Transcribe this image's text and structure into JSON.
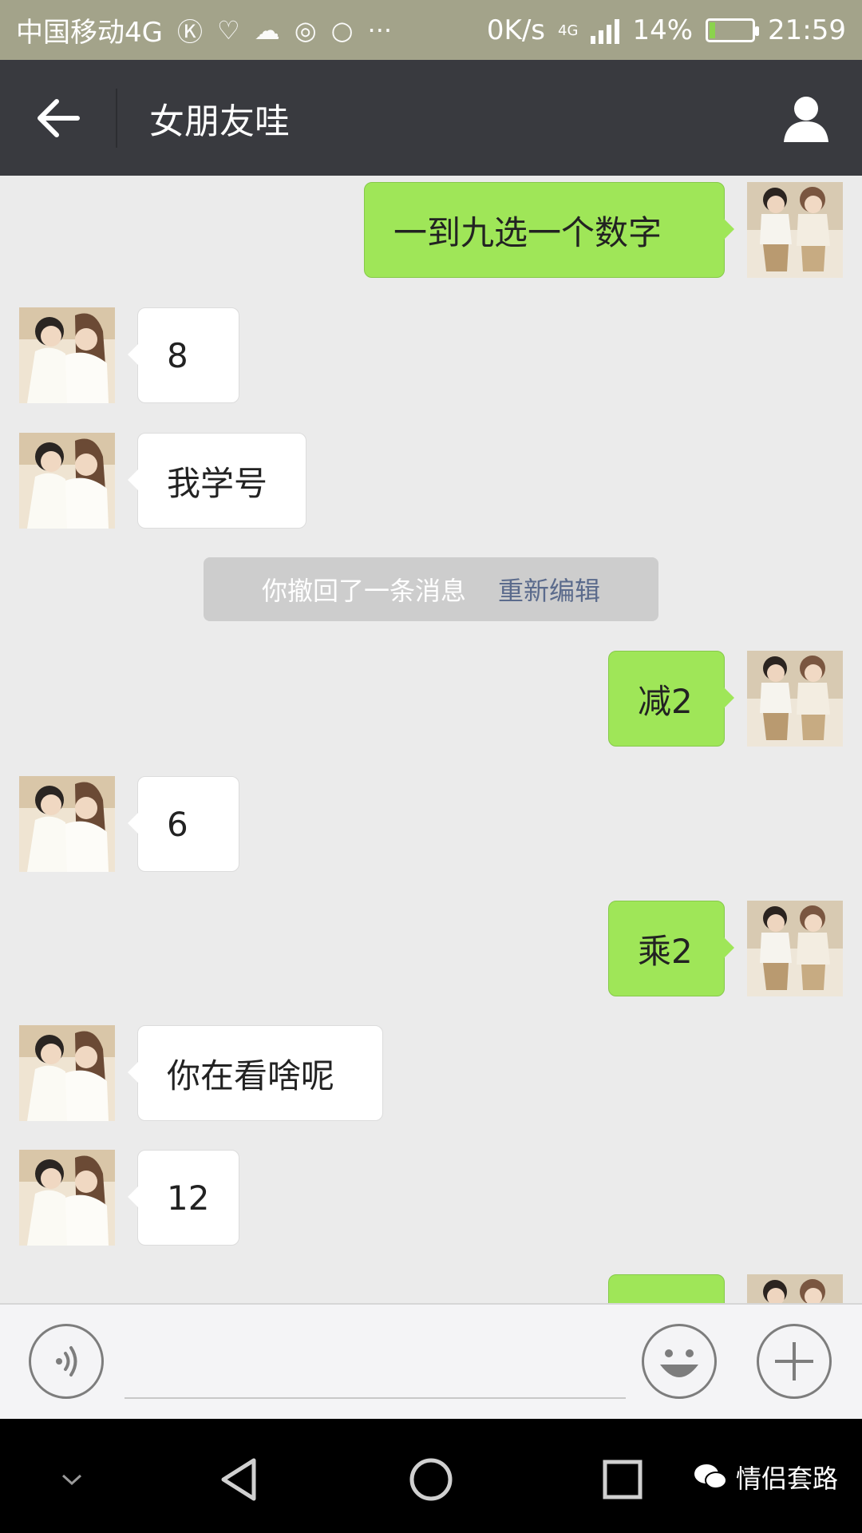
{
  "status_bar": {
    "carrier": "中国移动4G",
    "speed": "0K/s",
    "network": "4G",
    "battery": "14%",
    "battery_level": 0.14,
    "time": "21:59"
  },
  "header": {
    "title": "女朋友哇"
  },
  "messages": [
    {
      "side": "out",
      "text": "一到九选一个数字"
    },
    {
      "side": "in",
      "text": "8"
    },
    {
      "side": "in",
      "text": "我学号"
    },
    {
      "side": "system",
      "text": "你撤回了一条消息",
      "action": "重新编辑"
    },
    {
      "side": "out",
      "text": "减2"
    },
    {
      "side": "in",
      "text": "6"
    },
    {
      "side": "out",
      "text": "乘2"
    },
    {
      "side": "in",
      "text": "你在看啥呢"
    },
    {
      "side": "in",
      "text": "12"
    },
    {
      "side": "out",
      "text": ""
    }
  ],
  "input": {
    "value": "",
    "placeholder": ""
  },
  "watermark": "情侣套路",
  "colors": {
    "status_bar": "#a3a38a",
    "title_bar": "#393a3f",
    "chat_bg": "#ebebeb",
    "bubble_out": "#9fe658",
    "bubble_in": "#ffffff"
  }
}
